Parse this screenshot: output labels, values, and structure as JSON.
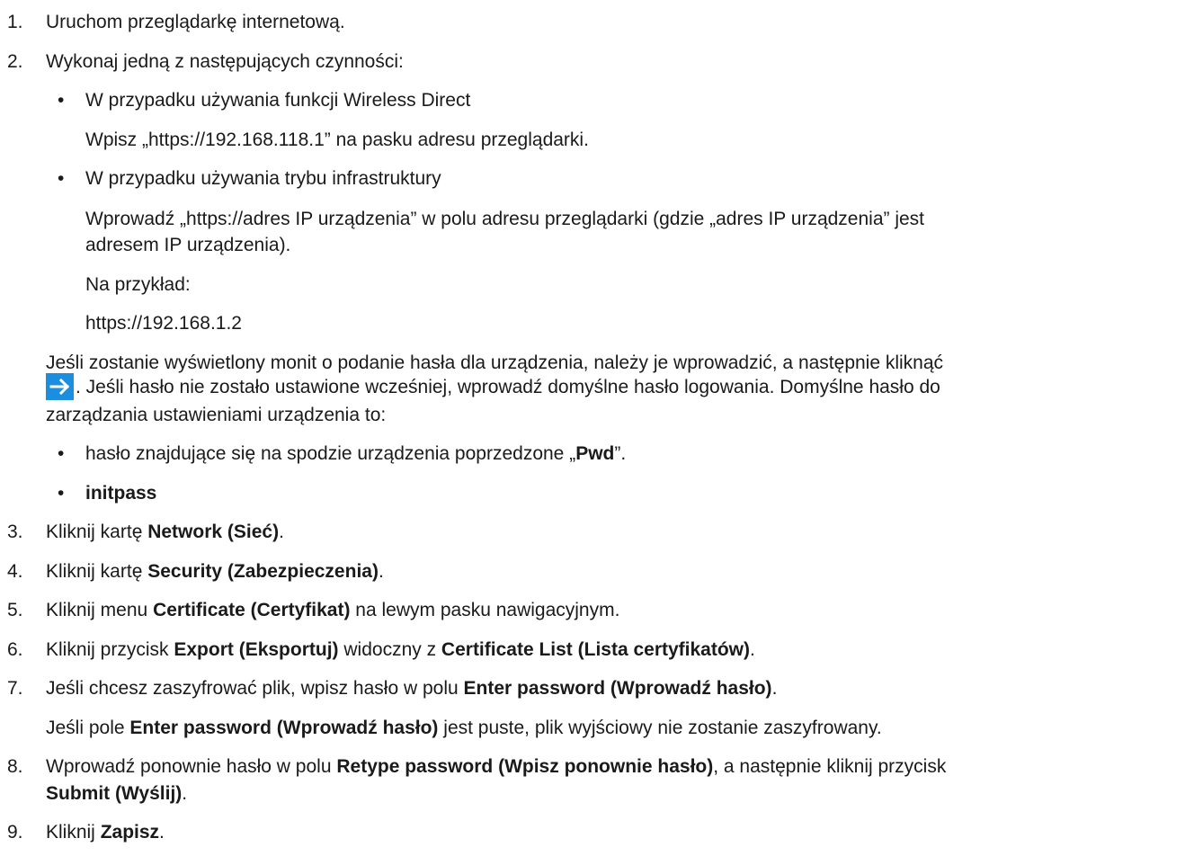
{
  "steps": {
    "s1": {
      "num": "1.",
      "text": "Uruchom przeglądarkę internetową."
    },
    "s2": {
      "num": "2.",
      "text": "Wykonaj jedną z następujących czynności:",
      "b1": {
        "bullet": "•",
        "title": "W przypadku używania funkcji Wireless Direct",
        "line1": "Wpisz „https://192.168.118.1” na pasku adresu przeglądarki."
      },
      "b2": {
        "bullet": "•",
        "title": "W przypadku używania trybu infrastruktury",
        "line1": "Wprowadź „https://adres IP urządzenia” w polu adresu przeglądarki (gdzie „adres IP urządzenia” jest",
        "line2": "adresem IP urządzenia).",
        "line3": "Na przykład:",
        "line4": "https://192.168.1.2"
      },
      "pw1": "Jeśli zostanie wyświetlony monit o podanie hasła dla urządzenia, należy je wprowadzić, a następnie kliknąć",
      "pw2": ". Jeśli hasło nie zostało ustawione wcześniej, wprowadź domyślne hasło logowania. Domyślne hasło do",
      "pw3": "zarządzania ustawieniami urządzenia to:",
      "b3": {
        "bullet": "•",
        "pre": "hasło znajdujące się na spodzie urządzenia poprzedzone „",
        "bold": "Pwd",
        "post": "”."
      },
      "b4": {
        "bullet": "•",
        "bold": "initpass"
      }
    },
    "s3": {
      "num": "3.",
      "pre": "Kliknij kartę ",
      "bold": "Network (Sieć)",
      "post": "."
    },
    "s4": {
      "num": "4.",
      "pre": "Kliknij kartę ",
      "bold": "Security (Zabezpieczenia)",
      "post": "."
    },
    "s5": {
      "num": "5.",
      "pre": "Kliknij menu ",
      "bold": "Certificate (Certyfikat)",
      "post": " na lewym pasku nawigacyjnym."
    },
    "s6": {
      "num": "6.",
      "pre": "Kliknij przycisk ",
      "bold": "Export (Eksportuj)",
      "mid": " widoczny z ",
      "bold2": "Certificate List (Lista certyfikatów)",
      "post": "."
    },
    "s7": {
      "num": "7.",
      "pre": "Jeśli chcesz zaszyfrować plik, wpisz hasło w polu ",
      "bold": "Enter password (Wprowadź hasło)",
      "post": ".",
      "l2pre": "Jeśli pole ",
      "l2bold": "Enter password (Wprowadź hasło)",
      "l2post": " jest puste, plik wyjściowy nie zostanie zaszyfrowany."
    },
    "s8": {
      "num": "8.",
      "pre": "Wprowadź ponownie hasło w polu ",
      "bold": "Retype password (Wpisz ponownie hasło)",
      "post": ", a następnie kliknij przycisk",
      "l2bold": "Submit (Wyślij)",
      "l2post": "."
    },
    "s9": {
      "num": "9.",
      "pre": "Kliknij ",
      "bold": "Zapisz",
      "post": "."
    }
  },
  "icons": {
    "arrow": "right-arrow-icon",
    "arrow_color": "#1b8ee0"
  }
}
